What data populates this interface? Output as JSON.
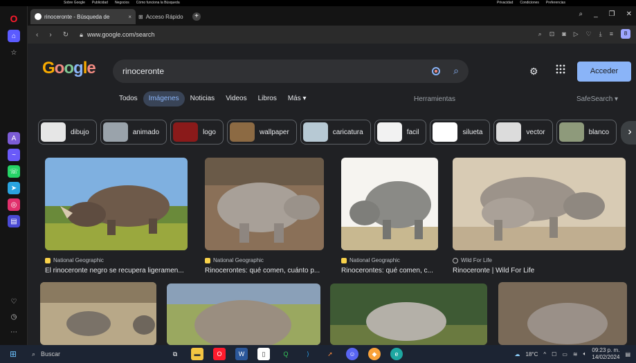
{
  "topstrip": {
    "left": [
      "Sobre Google",
      "Publicidad",
      "Negocios",
      "Cómo funciona la Búsqueda"
    ],
    "right": [
      "Privacidad",
      "Condiciones",
      "Preferencias"
    ]
  },
  "browser": {
    "active_tab": "rinoceronte - Búsqueda de",
    "inactive_tab": "Acceso Rápido",
    "url": "www.google.com/search",
    "account_initial": "8"
  },
  "google": {
    "logo": "Google",
    "query": "rinoceronte",
    "signin": "Acceder",
    "tabs": [
      "Todos",
      "Imágenes",
      "Noticias",
      "Videos",
      "Libros",
      "Más"
    ],
    "selected_tab": "Imágenes",
    "tools": "Herramientas",
    "safesearch": "SafeSearch"
  },
  "chips": [
    {
      "label": "dibujo",
      "color": "#e6e6e6"
    },
    {
      "label": "animado",
      "color": "#9aa3ab"
    },
    {
      "label": "logo",
      "color": "#8a1a1a"
    },
    {
      "label": "wallpaper",
      "color": "#8c6a43"
    },
    {
      "label": "caricatura",
      "color": "#b7c9d4"
    },
    {
      "label": "facil",
      "color": "#f2f2f2"
    },
    {
      "label": "silueta",
      "color": "#ffffff"
    },
    {
      "label": "vector",
      "color": "#dcdcdc"
    },
    {
      "label": "blanco",
      "color": "#8e9a7b"
    }
  ],
  "results_row1": [
    {
      "source": "National Geographic",
      "title": "El rinoceronte negro se recupera ligeramen...",
      "fav": "#f9d24a"
    },
    {
      "source": "National Geographic",
      "title": "Rinocerontes: qué comen, cuánto p...",
      "fav": "#f9d24a"
    },
    {
      "source": "National Geographic",
      "title": "Rinocerontes: qué comen, c...",
      "fav": "#f9d24a"
    },
    {
      "source": "Wild For Life",
      "title": "Rinoceronte | Wild For Life",
      "fav": "#202124"
    }
  ],
  "taskbar": {
    "search_placeholder": "Buscar",
    "weather": "18°C",
    "time": "09:23 p. m.",
    "date": "14/02/2024"
  }
}
